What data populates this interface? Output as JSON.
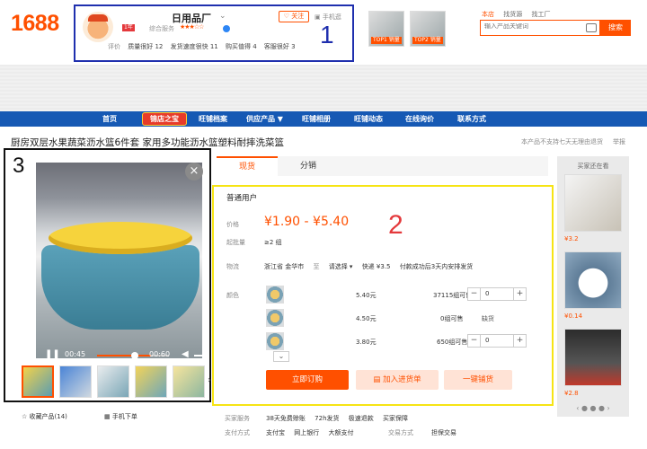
{
  "logo": "1688",
  "shop": {
    "name": "日用品厂",
    "follow_label": "关注",
    "mobile_label": "手机逛",
    "badge": "1年",
    "year_label": "级",
    "service_label": "综合服务",
    "stars": "★★★☆☆",
    "ratings_label": "评价",
    "ratings": [
      "质量很好 12",
      "发货速度很快 11",
      "购买值得 4",
      "客服很好 3"
    ],
    "annotation": "1"
  },
  "top_products": [
    {
      "badge": "TOP1 销量"
    },
    {
      "badge": "TOP2 销量"
    }
  ],
  "search": {
    "tabs": [
      "本店",
      "找货源",
      "找工厂"
    ],
    "placeholder": "输入产品关键词",
    "button_label": "搜索"
  },
  "nav": {
    "items": [
      "首页",
      "旺铺档案",
      "供应产品 ▼",
      "旺铺相册",
      "旺铺动态",
      "在线询价",
      "联系方式"
    ],
    "special": "锦店之宝"
  },
  "product": {
    "title": "厨房双层水果蔬菜沥水篮6件套 家用多功能沥水篮塑料耐摔洗菜篮",
    "notice": "本产品不支持七天无理由退货",
    "report": "举报"
  },
  "video": {
    "annotation": "3",
    "current_time": "00:45",
    "duration": "00:60",
    "progress": 0.75,
    "close_label": "×"
  },
  "gallery_actions": {
    "collect": "收藏产品(14)",
    "mobile_order": "手机下单"
  },
  "order": {
    "tabs": [
      "现货",
      "分销"
    ],
    "user_type": "普通用户",
    "price_label": "价格",
    "price": "¥1.90 - ¥5.40",
    "annotation": "2",
    "moq_label": "起批量",
    "moq": "≥2 组",
    "logistics_label": "物流",
    "logistics": [
      "浙江省 金华市",
      "至",
      "请选择 ▾",
      "快递 ¥3.5",
      "付款成功后3天内安排发货"
    ],
    "color_label": "颜色",
    "variants": [
      {
        "price": "5.40元",
        "stock": "37115组可售",
        "qty": "0",
        "status": ""
      },
      {
        "price": "4.50元",
        "stock": "0组可售",
        "qty": "",
        "status": "缺货"
      },
      {
        "price": "3.80元",
        "stock": "650组可售",
        "qty": "0",
        "status": ""
      }
    ],
    "more_label": "⌄",
    "buy_label": "立即订购",
    "add_label": "加入进货单",
    "publish_label": "一键铺货"
  },
  "services": {
    "label": "买家服务",
    "items": [
      "38天免费赊账",
      "72h发货",
      "极速退款",
      "买家保障"
    ],
    "pay_label": "支付方式",
    "pay_items": [
      "支付宝",
      "网上银行",
      "大额支付"
    ],
    "trade_label": "交易方式",
    "trade_value": "担保交易"
  },
  "sidebar": {
    "title": "买家还在看",
    "items": [
      {
        "price": "¥3.2"
      },
      {
        "price": "¥0.14"
      },
      {
        "price": "¥2.8"
      }
    ],
    "nav": "‹ ● ● ● ›"
  },
  "colors": {
    "accent": "#ff5000",
    "nav": "#1659b4",
    "annotation_blue": "#1f2fae",
    "annotation_yellow": "#f6e414"
  }
}
